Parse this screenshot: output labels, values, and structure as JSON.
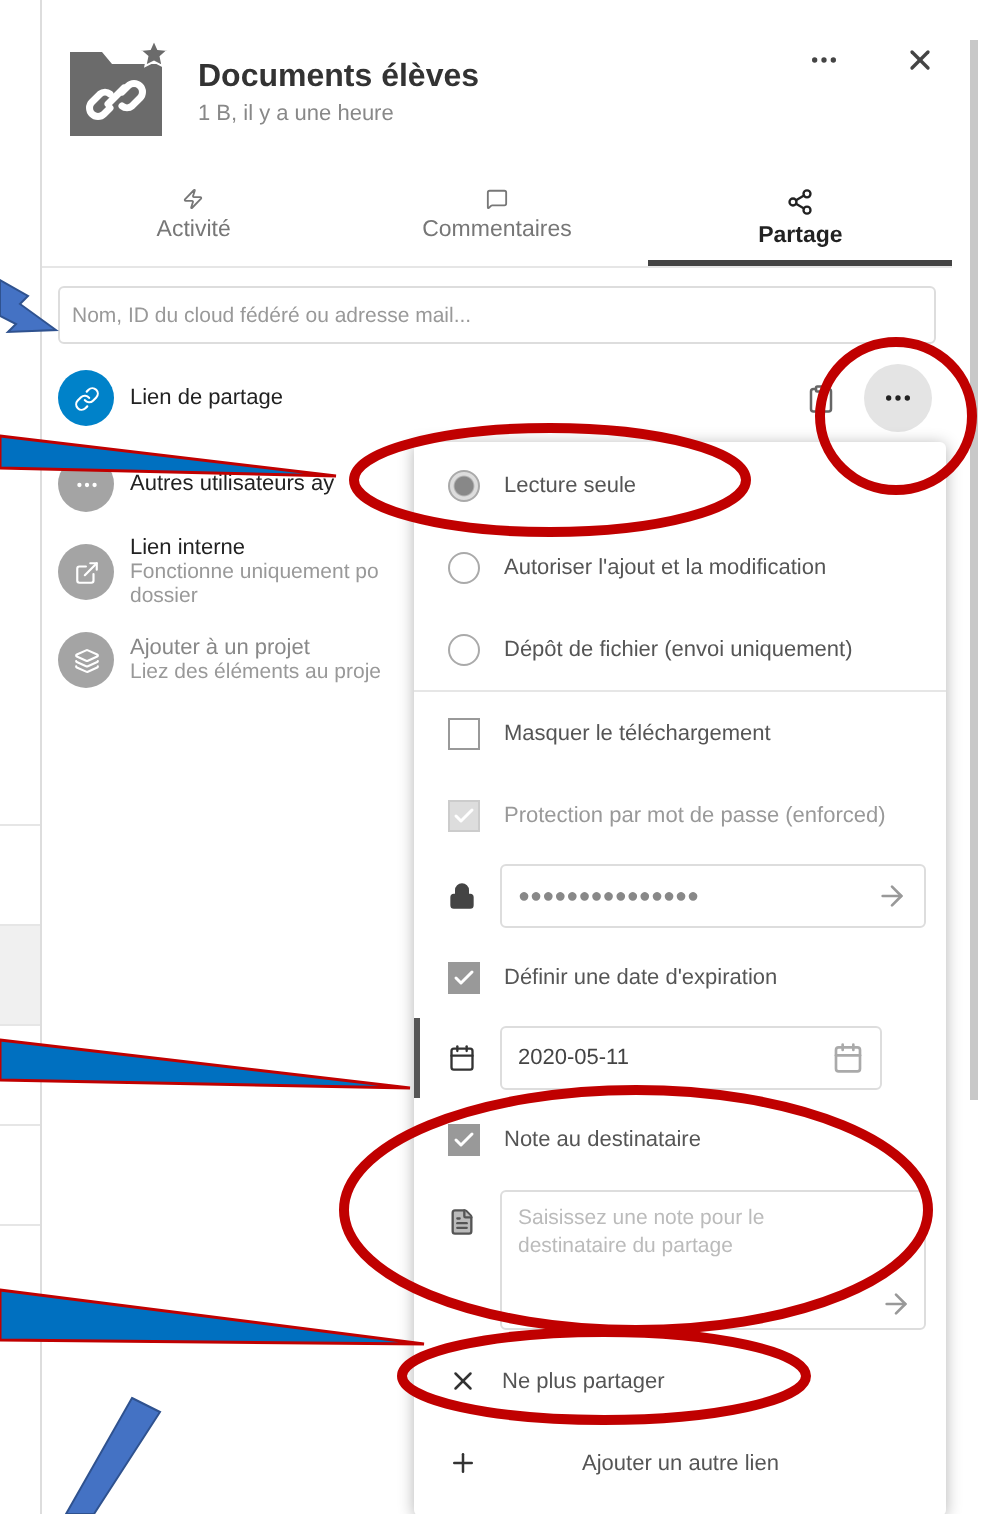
{
  "header": {
    "title": "Documents élèves",
    "subtitle": "1 B, il y a une heure"
  },
  "tabs": [
    {
      "label": "Activité",
      "selected": false
    },
    {
      "label": "Commentaires",
      "selected": false
    },
    {
      "label": "Partage",
      "selected": true
    }
  ],
  "search": {
    "placeholder": "Nom, ID du cloud fédéré ou adresse mail..."
  },
  "shares": [
    {
      "kind": "link",
      "title": "Lien de partage"
    },
    {
      "kind": "others",
      "title": "Autres utilisateurs ay"
    },
    {
      "kind": "internal",
      "title": "Lien interne",
      "subtitle": "Fonctionne uniquement po",
      "subtitle2": "dossier"
    },
    {
      "kind": "project",
      "title": "Ajouter à un projet",
      "subtitle": "Liez des éléments au proje"
    }
  ],
  "menu": [
    {
      "kind": "radio",
      "label": "Lecture seule",
      "selected": true
    },
    {
      "kind": "radio",
      "label": "Autoriser l'ajout et la modification",
      "selected": false
    },
    {
      "kind": "radio",
      "label": "Dépôt de fichier (envoi uniquement)",
      "selected": false
    },
    {
      "kind": "divider"
    },
    {
      "kind": "checkbox",
      "label": "Masquer le téléchargement",
      "checked": false,
      "disabled": false
    },
    {
      "kind": "checkbox",
      "label": "Protection par mot de passe (enforced)",
      "checked": true,
      "disabled": true
    },
    {
      "kind": "password",
      "value": "●●●●●●●●●●●●●●●"
    },
    {
      "kind": "checkbox",
      "label": "Définir une date d'expiration",
      "checked": true,
      "disabled": false
    },
    {
      "kind": "date",
      "value": "2020-05-11"
    },
    {
      "kind": "checkbox",
      "label": "Note au destinataire",
      "checked": true,
      "disabled": false
    },
    {
      "kind": "note",
      "placeholder": "Saisissez une note pour le destinataire du partage"
    },
    {
      "kind": "unshare",
      "label": "Ne plus partager"
    },
    {
      "kind": "add",
      "label": "Ajouter un autre lien"
    }
  ]
}
